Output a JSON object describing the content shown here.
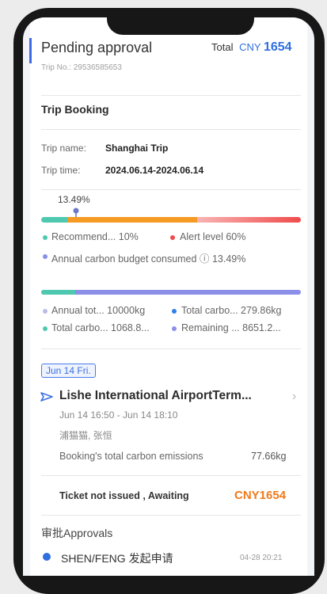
{
  "header": {
    "status": "Pending approval",
    "total_label": "Total",
    "currency": "CNY",
    "total_amount": "1654",
    "trip_no": "Trip No.: 29536585653"
  },
  "booking": {
    "section_title": "Trip Booking",
    "trip_name_label": "Trip name:",
    "trip_name": "Shanghai Trip",
    "trip_time_label": "Trip time:",
    "trip_time": "2024.06.14-2024.06.14"
  },
  "carbon": {
    "consumed_percent": 13.49,
    "percent_label": "13.49%",
    "recommend_percent": 10,
    "alert_percent": 60,
    "legend_recommend": "Recommend... 10%",
    "legend_alert": "Alert level 60%",
    "legend_consumed": "Annual carbon budget consumed",
    "info_glyph": "ⓘ",
    "legend_consumed_value": "13.49%",
    "budget_bar_used_fraction": 0.13,
    "stats": {
      "annual_total": "Annual tot...  10000kg",
      "total_carbon": "Total carbo... 279.86kg",
      "total_carbon_2": "Total carbo... 1068.8...",
      "remaining": "Remaining ... 8651.2..."
    },
    "colors": {
      "teal": "#4ec9b0",
      "orange": "#f59a23",
      "red": "#f04b4b",
      "light_red": "#f9b4b4",
      "purple": "#8b8fe8",
      "blue": "#2f80ed",
      "marker": "#6c79c9"
    }
  },
  "flight": {
    "date_tag": "Jun 14 Fri.",
    "icon": "flight-icon",
    "name": "Lishe International AirportTerm...",
    "time": "Jun 14 16:50 - Jun 14 18:10",
    "passengers": "浦猫猫, 张恒",
    "emissions_label": "Booking's total carbon emissions",
    "emissions_value": "77.66kg",
    "ticket_status": "Ticket not issued , Awaiting",
    "price": "CNY1654"
  },
  "approval": {
    "section_title": "审批Approvals",
    "entry_name": "SHEN/FENG 发起申请",
    "entry_time": "04-28 20:21"
  }
}
